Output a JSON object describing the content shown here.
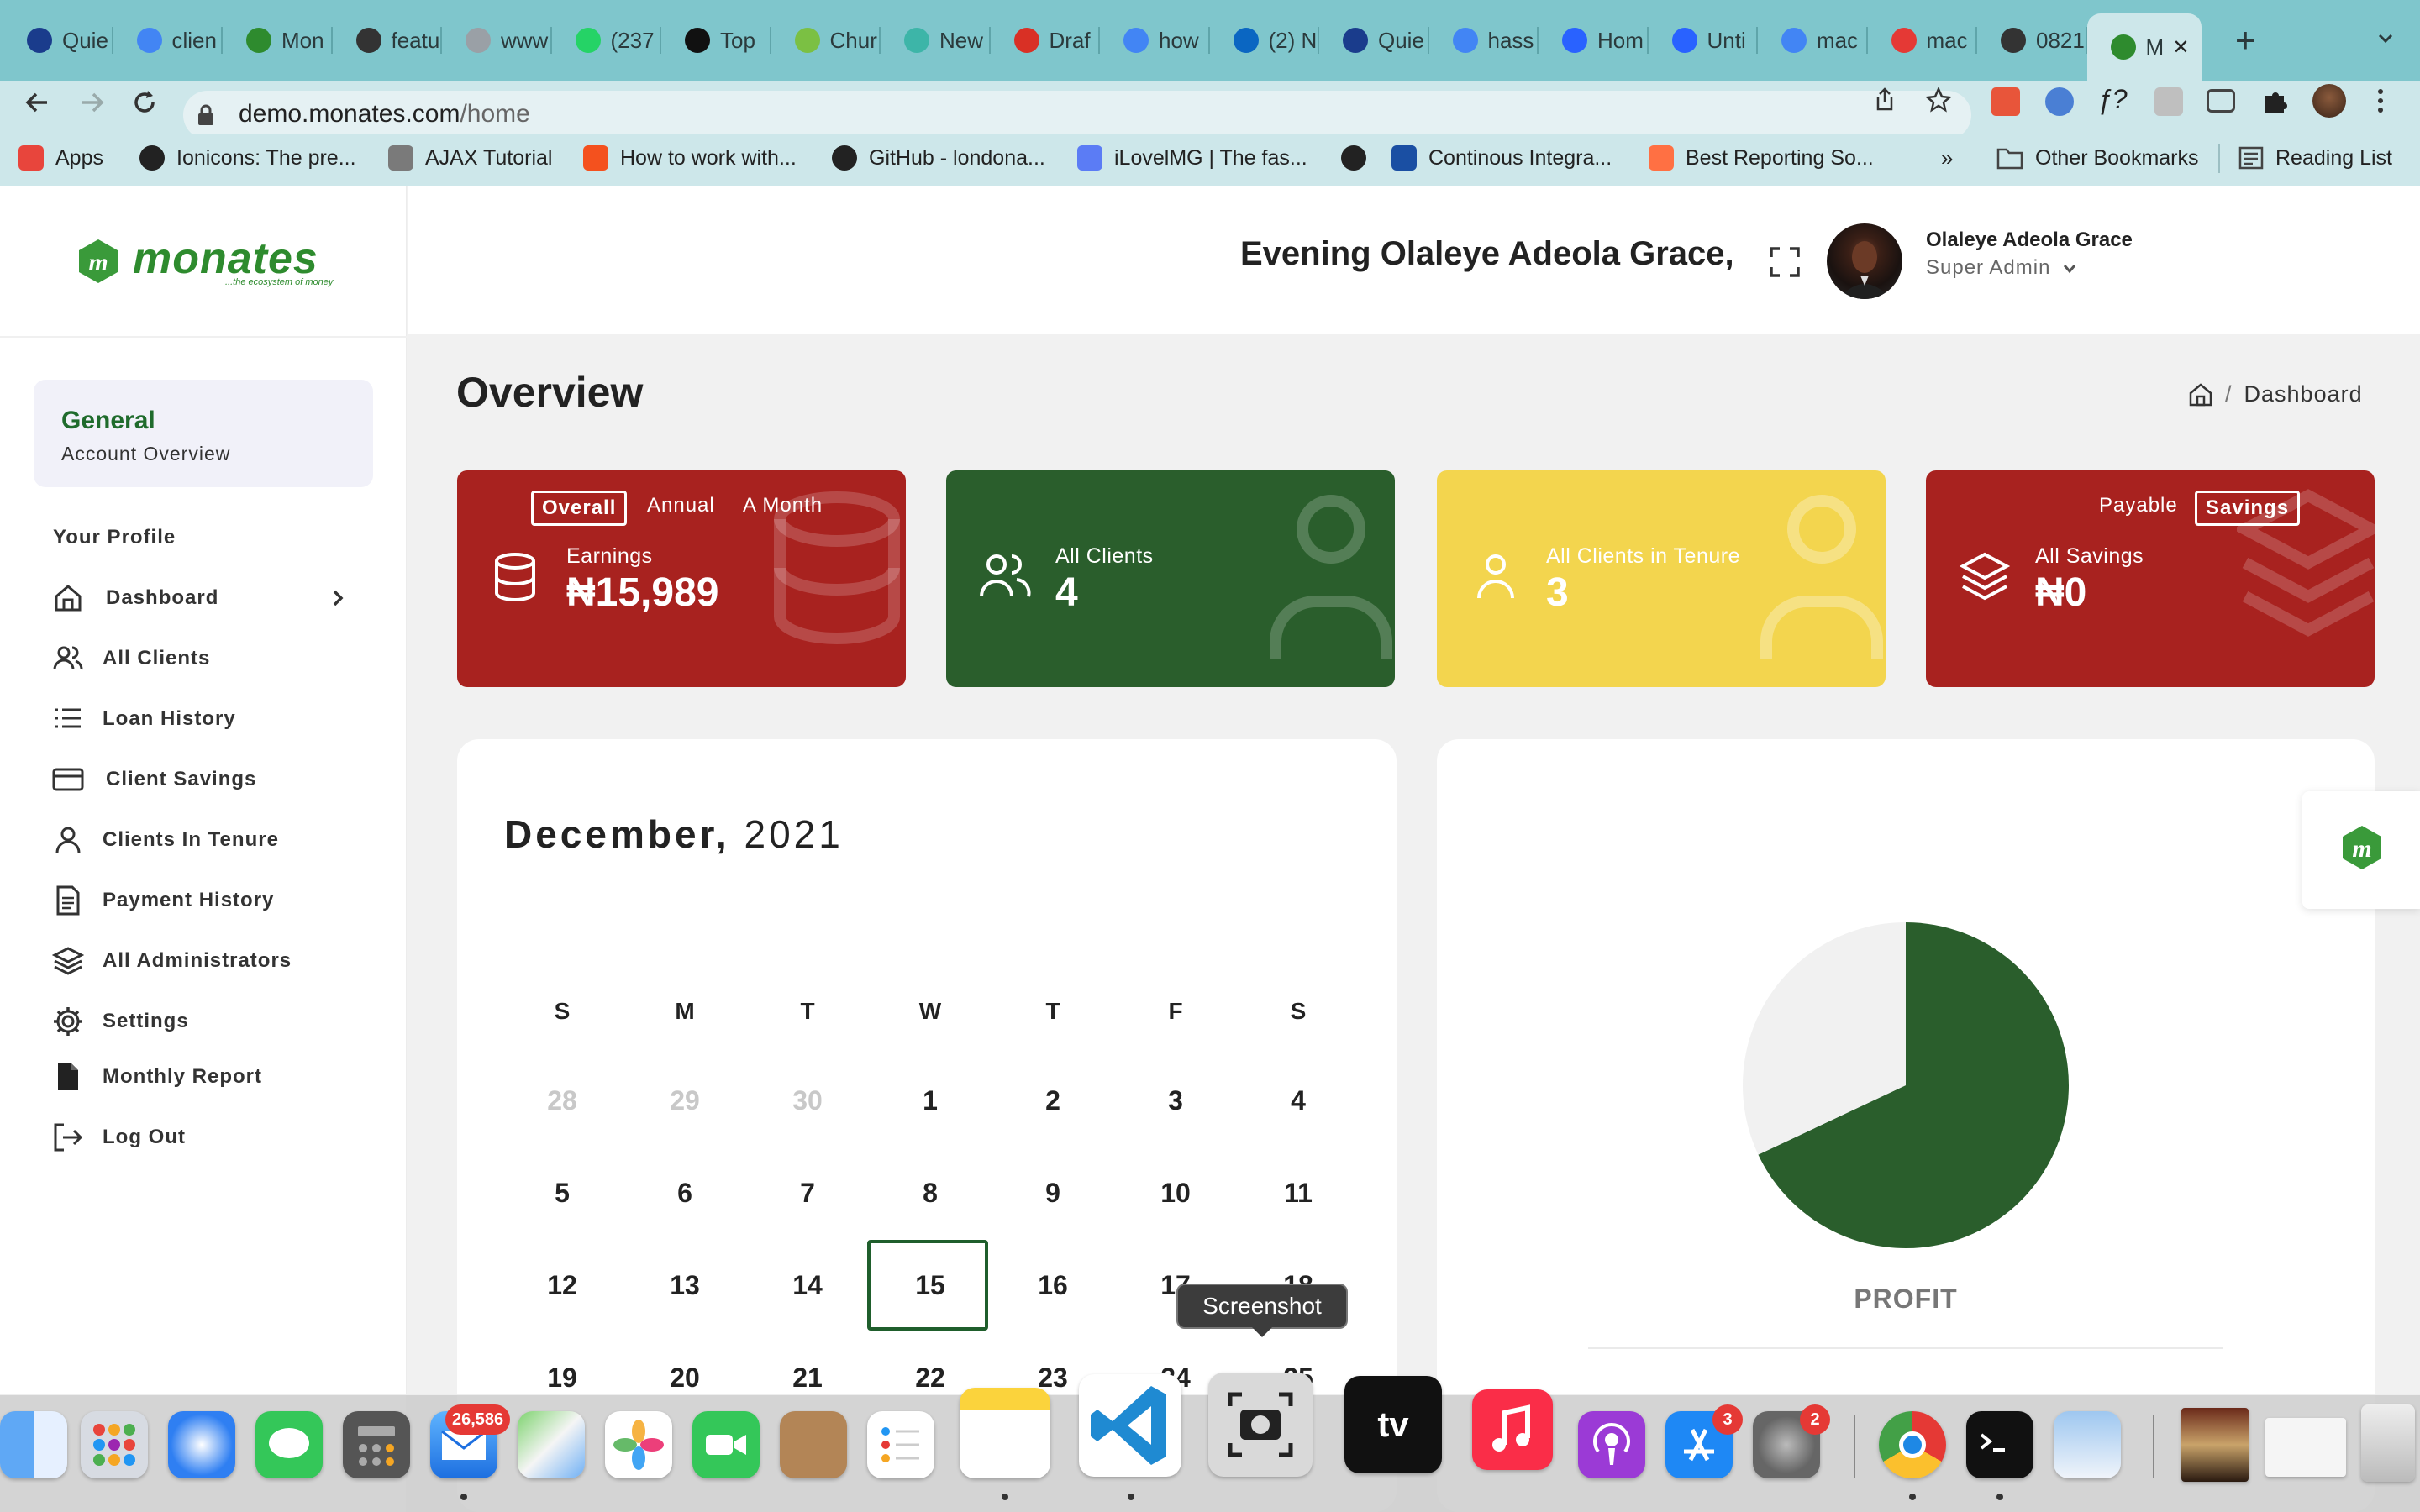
{
  "browser": {
    "tabs": [
      {
        "title": "Quie",
        "color": "#1a3c8c"
      },
      {
        "title": "clien",
        "color": "#4285f4"
      },
      {
        "title": "Mon",
        "color": "#2e8b2e"
      },
      {
        "title": "featu",
        "color": "#333333"
      },
      {
        "title": "www",
        "color": "#9aa0a6"
      },
      {
        "title": "(237",
        "color": "#25d366"
      },
      {
        "title": "Top",
        "color": "#111111"
      },
      {
        "title": "Chur",
        "color": "#7bc043"
      },
      {
        "title": "New",
        "color": "#3db5a8"
      },
      {
        "title": "Draf",
        "color": "#d93025"
      },
      {
        "title": "how",
        "color": "#4285f4"
      },
      {
        "title": "(2) N",
        "color": "#0a66c2"
      },
      {
        "title": "Quie",
        "color": "#1a3c8c"
      },
      {
        "title": "hass",
        "color": "#4285f4"
      },
      {
        "title": "Hom",
        "color": "#2962ff"
      },
      {
        "title": "Unti",
        "color": "#2962ff"
      },
      {
        "title": "mac",
        "color": "#4285f4"
      },
      {
        "title": "mac",
        "color": "#e53935"
      },
      {
        "title": "0821",
        "color": "#333333"
      },
      {
        "title": "M",
        "color": "#2e8b2e"
      }
    ],
    "url_host": "demo.monates.com",
    "url_path": "/home",
    "bookmarks": [
      {
        "label": "Apps",
        "color": "#e8453c"
      },
      {
        "label": "Ionicons: The pre...",
        "color": "#222222"
      },
      {
        "label": "AJAX Tutorial",
        "color": "#7a7a7a"
      },
      {
        "label": "How to work with...",
        "color": "#f4511e"
      },
      {
        "label": "GitHub - londona...",
        "color": "#222222"
      },
      {
        "label": "iLovelMG | The fas...",
        "color": "#5b7cf5"
      },
      {
        "label": "",
        "color": "#222222"
      },
      {
        "label": "Continous Integra...",
        "color": "#1a4fa3"
      },
      {
        "label": "Best Reporting So...",
        "color": "#ff7043"
      }
    ],
    "more_bookmarks": "»",
    "other_bookmarks": "Other Bookmarks",
    "reading_list": "Reading List"
  },
  "app": {
    "logo": "monates",
    "logo_tagline": "...the ecosystem of money",
    "greeting": "Evening Olaleye Adeola Grace,",
    "user_name": "Olaleye Adeola Grace",
    "user_role": "Super Admin",
    "page_title": "Overview",
    "breadcrumb": "Dashboard",
    "sidebar": {
      "general_title": "General",
      "general_sub": "Account Overview",
      "profile_heading": "Your Profile",
      "items": [
        {
          "label": "Dashboard",
          "icon": "home-icon"
        },
        {
          "label": "All Clients",
          "icon": "users-icon"
        },
        {
          "label": "Loan History",
          "icon": "list-icon"
        },
        {
          "label": "Client Savings",
          "icon": "card-icon"
        },
        {
          "label": "Clients In Tenure",
          "icon": "user-icon"
        },
        {
          "label": "Payment History",
          "icon": "document-icon"
        },
        {
          "label": "All Administrators",
          "icon": "layers-icon"
        },
        {
          "label": "Settings",
          "icon": "gear-icon"
        },
        {
          "label": "Monthly Report",
          "icon": "file-icon"
        },
        {
          "label": "Log Out",
          "icon": "logout-icon"
        }
      ]
    },
    "cards": {
      "earnings": {
        "label": "Earnings",
        "value": "₦15,989",
        "tabs": [
          "Overall",
          "Annual",
          "A Month"
        ],
        "active_tab": "Overall",
        "color": "#a8221f"
      },
      "clients": {
        "label": "All Clients",
        "value": "4",
        "color": "#2a5e2c"
      },
      "tenure": {
        "label": "All Clients in Tenure",
        "value": "3",
        "color": "#f3d54e"
      },
      "savings": {
        "label": "All Savings",
        "value": "₦0",
        "tabs": [
          "Payable",
          "Savings"
        ],
        "active_tab": "Savings",
        "color": "#a8221f"
      }
    },
    "calendar": {
      "month": "December,",
      "year": "2021",
      "weekdays": [
        "S",
        "M",
        "T",
        "W",
        "T",
        "F",
        "S"
      ],
      "weeks": [
        [
          "28",
          "29",
          "30",
          "1",
          "2",
          "3",
          "4"
        ],
        [
          "5",
          "6",
          "7",
          "8",
          "9",
          "10",
          "11"
        ],
        [
          "12",
          "13",
          "14",
          "15",
          "16",
          "17",
          "18"
        ],
        [
          "19",
          "20",
          "21",
          "22",
          "23",
          "24",
          "25"
        ]
      ],
      "selected": "15"
    },
    "chart_data": {
      "type": "pie",
      "slices": [
        {
          "value": 68,
          "color": "#2a5e2c"
        },
        {
          "value": 32,
          "color": "#f1f1f1"
        }
      ],
      "caption": "PROFIT"
    }
  },
  "dock": {
    "tooltip": "Screenshot",
    "badges": {
      "mail": "26,586",
      "app_store": "3",
      "settings": "2"
    }
  }
}
